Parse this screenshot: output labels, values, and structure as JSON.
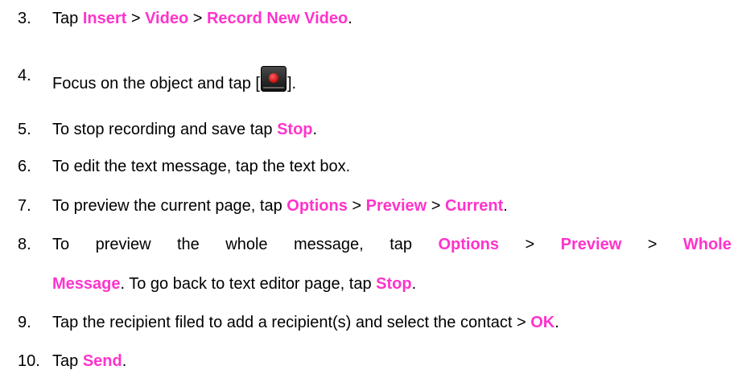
{
  "colors": {
    "text": "#000000",
    "keyword": "#ff33cc",
    "record_button_bg": "#222222",
    "record_button_dot": "#e00000"
  },
  "steps": {
    "s3": {
      "num": "3.",
      "t1": "Tap ",
      "k1": "Insert",
      "t2": " > ",
      "k2": "Video",
      "t3": " > ",
      "k3": "Record New Video",
      "t4": "."
    },
    "s4": {
      "num": "4.",
      "t1": "Focus on the object and tap [",
      "icon": "record-button-icon",
      "t2": "]."
    },
    "s5": {
      "num": "5.",
      "t1": "To stop recording and save tap ",
      "k1": "Stop",
      "t2": "."
    },
    "s6": {
      "num": "6.",
      "t1": "To edit the text message, tap the text box."
    },
    "s7": {
      "num": "7.",
      "t1": "To preview the current page, tap ",
      "k1": "Options",
      "t2": " > ",
      "k2": "Preview",
      "t3": " > ",
      "k3": "Current",
      "t4": "."
    },
    "s8": {
      "num": "8.",
      "words": [
        "To",
        "preview",
        "the",
        "whole",
        "message,",
        "tap"
      ],
      "k1": "Options",
      "sep1": ">",
      "k2": "Preview",
      "sep2": ">",
      "k3": "Whole",
      "k4": "Message",
      "t2": ". To go back to text editor page, tap ",
      "k5": "Stop",
      "t3": "."
    },
    "s9": {
      "num": "9.",
      "t1": "Tap the recipient filed to add a recipient(s) and select the contact > ",
      "k1": "OK",
      "t2": "."
    },
    "s10": {
      "num": "10.",
      "t1": "Tap ",
      "k1": "Send",
      "t2": "."
    }
  }
}
